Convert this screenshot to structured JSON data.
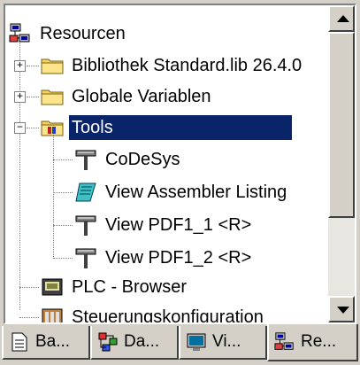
{
  "tree": {
    "items": [
      {
        "label": "Resourcen",
        "icon": "resources-icon"
      },
      {
        "label": "Bibliothek Standard.lib 26.4.0",
        "icon": "folder-icon"
      },
      {
        "label": "Globale Variablen",
        "icon": "folder-icon"
      },
      {
        "label": "Tools",
        "icon": "tools-folder-icon"
      },
      {
        "label": "CoDeSys",
        "icon": "hammer-icon"
      },
      {
        "label": "View Assembler Listing",
        "icon": "notebook-icon"
      },
      {
        "label": "View PDF1_1 <R>",
        "icon": "hammer-icon"
      },
      {
        "label": "View PDF1_2 <R>",
        "icon": "hammer-icon"
      },
      {
        "label": "PLC - Browser",
        "icon": "plc-icon"
      },
      {
        "label": "Steuerungskonfiguration",
        "icon": "config-icon"
      }
    ]
  },
  "tabs": [
    {
      "label": "Ba...",
      "icon": "document-icon"
    },
    {
      "label": "Da...",
      "icon": "datatypes-icon"
    },
    {
      "label": "Vi...",
      "icon": "visualization-icon"
    },
    {
      "label": "Re...",
      "icon": "resources-icon"
    }
  ],
  "colors": {
    "selection": "#0a246a",
    "face": "#d4d0c8",
    "folder": "#f4d35e"
  }
}
